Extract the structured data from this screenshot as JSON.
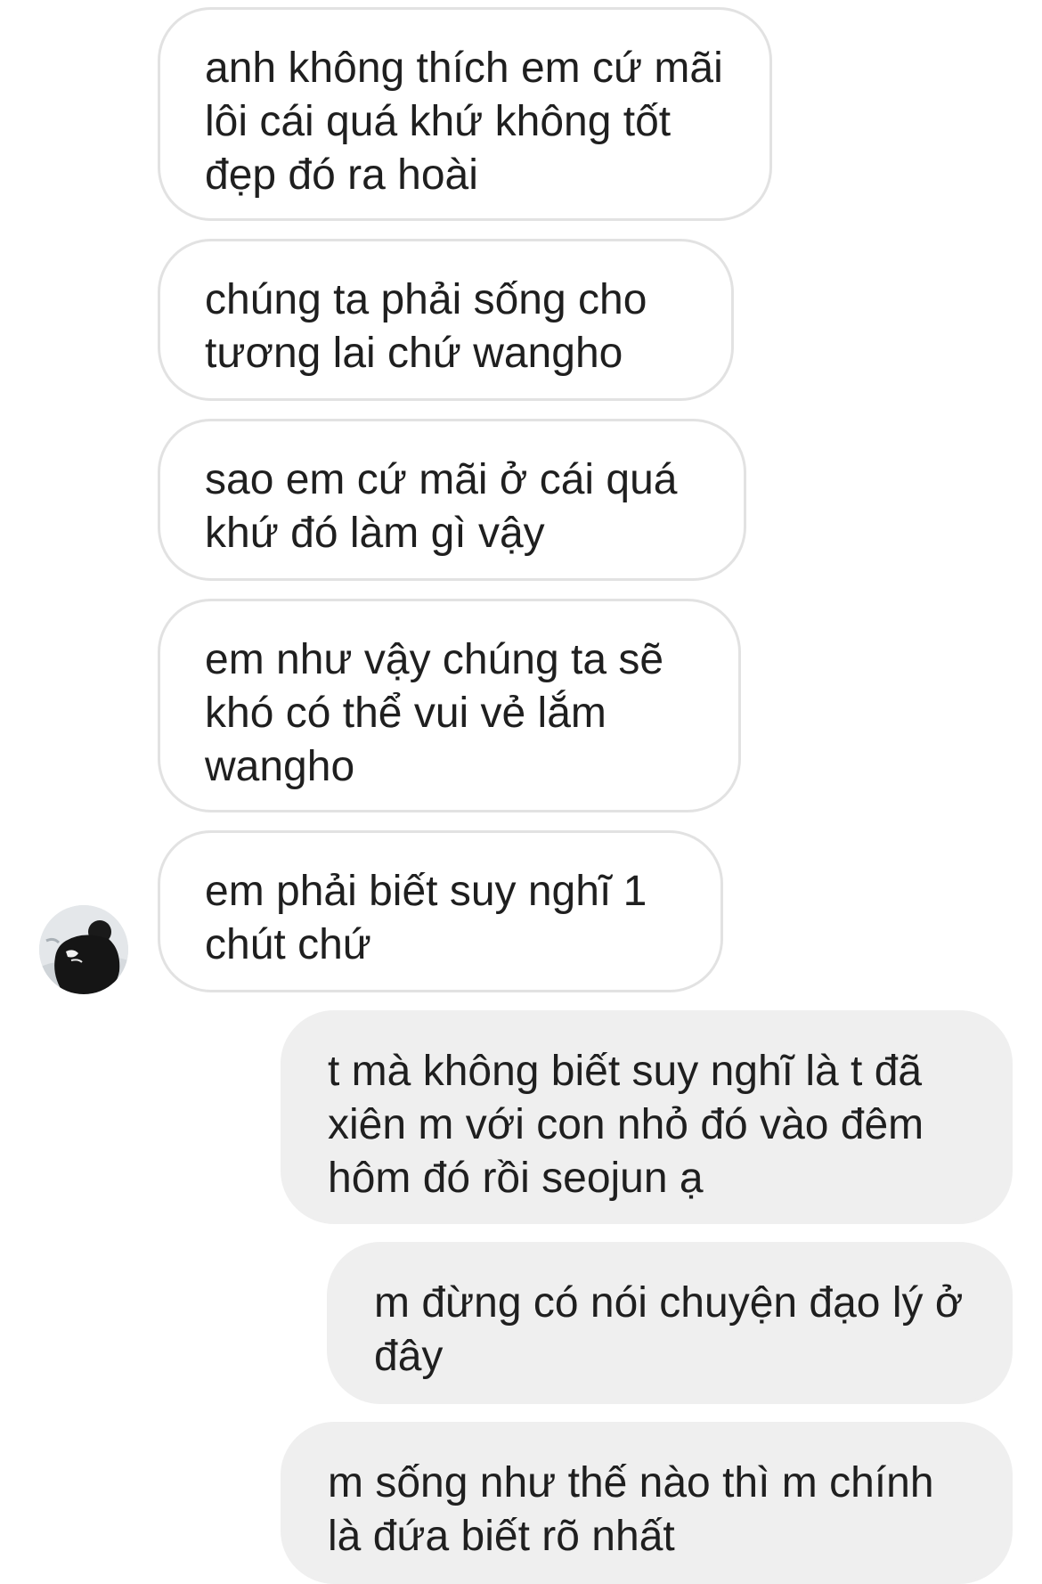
{
  "conversation": {
    "messages": [
      {
        "sender": "other",
        "text": "anh không thích em cứ mãi lôi cái quá khứ không tốt đẹp đó ra hoài"
      },
      {
        "sender": "other",
        "text": "chúng ta phải sống cho tương lai chứ wangho"
      },
      {
        "sender": "other",
        "text": "sao em cứ mãi ở cái quá khứ đó làm gì vậy"
      },
      {
        "sender": "other",
        "text": "em như vậy chúng ta sẽ khó có thể vui vẻ lắm wangho"
      },
      {
        "sender": "other",
        "text": "em phải biết suy nghĩ 1 chút chứ"
      },
      {
        "sender": "me",
        "text": "t mà không biết suy nghĩ là t đã xiên m với con nhỏ đó vào đêm hôm đó rồi seojun ạ"
      },
      {
        "sender": "me",
        "text": "m đừng có nói chuyện đạo lý ở đây"
      },
      {
        "sender": "me",
        "text": "m sống như thế nào thì m chính là đứa biết rõ nhất"
      }
    ]
  },
  "avatar": {
    "icon": "contact-avatar-photo"
  },
  "colors": {
    "incoming_bubble": "#ffffff",
    "incoming_border": "#e2e2e2",
    "outgoing_bubble": "#efefef",
    "text": "#1f1f1f"
  }
}
